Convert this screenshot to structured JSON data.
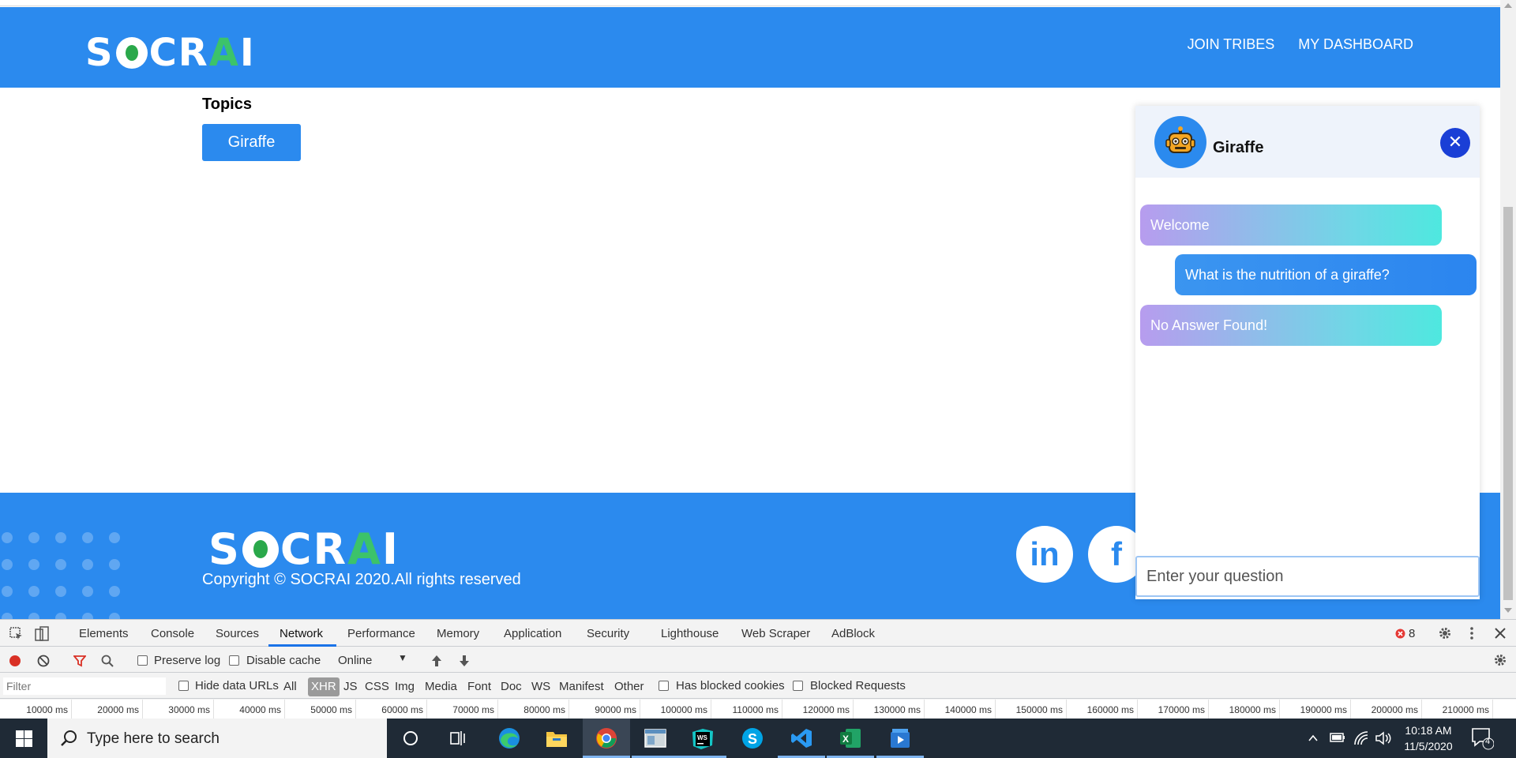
{
  "header": {
    "logo_text": "SOCRAI",
    "nav": [
      {
        "label": "JOIN TRIBES"
      },
      {
        "label": "MY DASHBOARD"
      }
    ]
  },
  "topics": {
    "heading": "Topics",
    "items": [
      {
        "label": "Giraffe"
      }
    ]
  },
  "chat": {
    "title": "Giraffe",
    "close_icon": "close-icon",
    "avatar_icon": "robot-icon",
    "messages": [
      {
        "from": "bot",
        "text": "Welcome"
      },
      {
        "from": "user",
        "text": "What is the nutrition of a giraffe?"
      },
      {
        "from": "bot",
        "text": "No Answer Found!"
      }
    ],
    "input_placeholder": "Enter your question"
  },
  "footer": {
    "logo_text": "SOCRAI",
    "copyright": "Copyright © SOCRAI 2020.All rights reserved",
    "social": [
      {
        "name": "linkedin-icon",
        "glyph": "in"
      },
      {
        "name": "facebook-icon",
        "glyph": "f"
      }
    ]
  },
  "devtools": {
    "tabs": [
      "Elements",
      "Console",
      "Sources",
      "Network",
      "Performance",
      "Memory",
      "Application",
      "Security",
      "Lighthouse",
      "Web Scraper",
      "AdBlock"
    ],
    "active_tab": "Network",
    "error_count": "8",
    "preserve_log": "Preserve log",
    "disable_cache": "Disable cache",
    "throttle": "Online",
    "filter_placeholder": "Filter",
    "hide_data_urls": "Hide data URLs",
    "types": [
      "All",
      "XHR",
      "JS",
      "CSS",
      "Img",
      "Media",
      "Font",
      "Doc",
      "WS",
      "Manifest",
      "Other"
    ],
    "active_type": "XHR",
    "has_blocked_cookies": "Has blocked cookies",
    "blocked_requests": "Blocked Requests",
    "timeline_ticks": [
      "10000 ms",
      "20000 ms",
      "30000 ms",
      "40000 ms",
      "50000 ms",
      "60000 ms",
      "70000 ms",
      "80000 ms",
      "90000 ms",
      "100000 ms",
      "110000 ms",
      "120000 ms",
      "130000 ms",
      "140000 ms",
      "150000 ms",
      "160000 ms",
      "170000 ms",
      "180000 ms",
      "190000 ms",
      "200000 ms",
      "210000 ms"
    ]
  },
  "taskbar": {
    "search_placeholder": "Type here to search",
    "time": "10:18 AM",
    "date": "11/5/2020",
    "notification_count": "4"
  },
  "colors": {
    "brand_blue": "#2b8aee",
    "close_blue": "#1a3fd6",
    "taskbar": "#1f2a36"
  }
}
